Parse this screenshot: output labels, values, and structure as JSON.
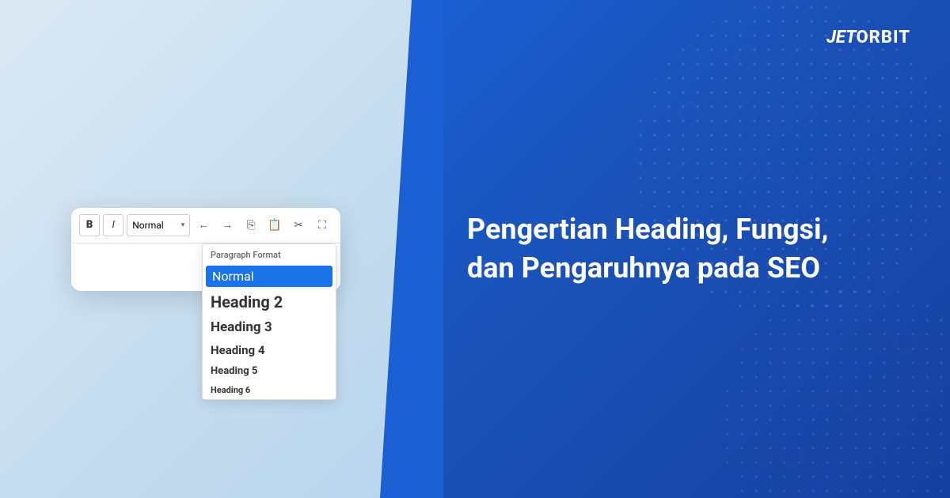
{
  "brand": {
    "name": "JETORBIT"
  },
  "left": {
    "toolbar": {
      "bold_label": "B",
      "italic_label": "I",
      "format_value": "Normal",
      "format_arrow_down": "▾",
      "undo_icon": "←",
      "redo_icon": "→",
      "copy_icon": "⎘",
      "paste_icon": "📋",
      "cut_icon": "✂",
      "expand_icon": "⛶"
    },
    "dropdown": {
      "label": "Paragraph Format",
      "items": [
        {
          "id": "normal",
          "label": "Normal",
          "class": "normal",
          "selected": true
        },
        {
          "id": "h2",
          "label": "Heading 2",
          "class": "h2",
          "selected": false
        },
        {
          "id": "h3",
          "label": "Heading 3",
          "class": "h3",
          "selected": false
        },
        {
          "id": "h4",
          "label": "Heading 4",
          "class": "h4",
          "selected": false
        },
        {
          "id": "h5",
          "label": "Heading 5",
          "class": "h5",
          "selected": false
        },
        {
          "id": "h6",
          "label": "Heading 6",
          "class": "h6",
          "selected": false
        }
      ]
    }
  },
  "right": {
    "heading_line1": "Pengertian Heading, Fungsi,",
    "heading_line2": "dan Pengaruhnya pada SEO"
  }
}
